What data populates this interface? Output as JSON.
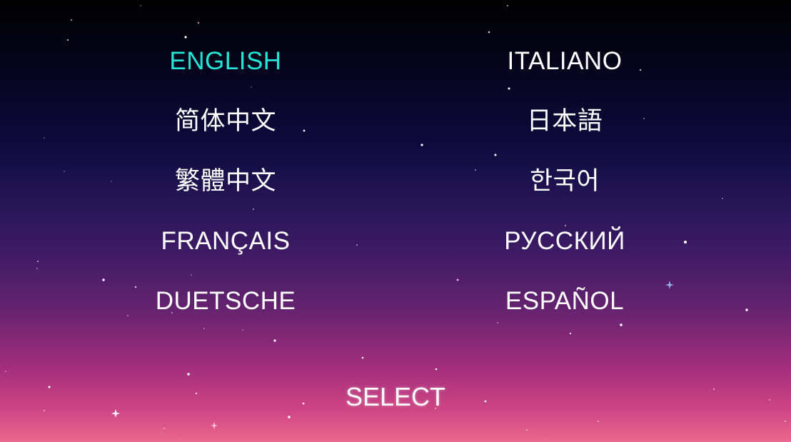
{
  "languages": {
    "left": [
      "ENGLISH",
      "简体中文",
      "繁體中文",
      "FRANÇAIS",
      "DUETSCHE"
    ],
    "right": [
      "ITALIANO",
      "日本語",
      "한국어",
      "РУССКИЙ",
      "ESPAÑOL"
    ]
  },
  "selected_language": "ENGLISH",
  "select_label": "SELECT",
  "colors": {
    "selected": "#24e4d6",
    "text": "#ffffff",
    "bg_top": "#000000",
    "bg_bottom": "#e96a8e"
  }
}
